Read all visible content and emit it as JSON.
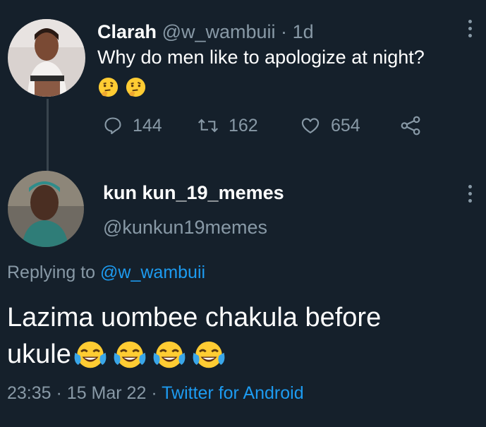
{
  "tweet": {
    "author_name": "Clarah",
    "author_handle": "@w_wambuii",
    "separator": "·",
    "age": "1d",
    "text": "Why do men like to apologize at night?",
    "emojis": [
      "thinking-face",
      "thinking-face"
    ],
    "stats": {
      "replies": "144",
      "retweets": "162",
      "likes": "654"
    }
  },
  "reply": {
    "author_name": "kun kun_19_memes",
    "author_handle": "@kunkun19memes",
    "replying_prefix": "Replying to",
    "replying_handle": "@w_wambuii",
    "text_line1": "Lazima uombee chakula before",
    "text_line2": "ukule",
    "emojis": [
      "tears-of-joy",
      "tears-of-joy",
      "tears-of-joy",
      "tears-of-joy"
    ],
    "time": "23:35",
    "dot1": "·",
    "date": "15 Mar 22",
    "dot2": "·",
    "source": "Twitter for Android"
  },
  "colors": {
    "background": "#15202b",
    "text": "#ffffff",
    "secondary": "#8899a6",
    "link": "#1d9bf0",
    "thread_line": "#38444d"
  }
}
